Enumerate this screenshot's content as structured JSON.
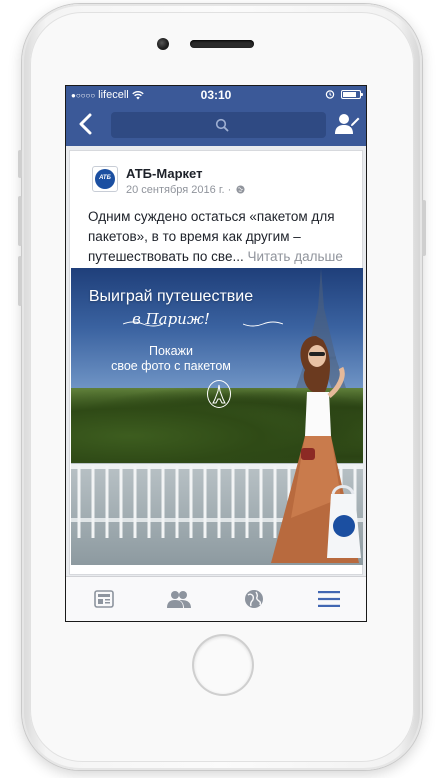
{
  "status_bar": {
    "signal_dots": "●○○○○",
    "carrier": "lifecell",
    "time": "03:10",
    "battery_level": 0.85
  },
  "nav": {
    "back_icon": "chevron-left-icon",
    "search_icon": "search-icon",
    "friends_icon": "friend-requests-icon",
    "accent_color": "#3b5998"
  },
  "post": {
    "page_name": "АТБ-Маркет",
    "avatar_logo_text": "АТБ",
    "date": "20 сентября 2016 г. · ",
    "text": "Одним суждено остаться «пакетом для пакетов», в то время как другим – путешествовать по све...",
    "read_more": " Читать дальше",
    "image": {
      "headline": "Выиграй путешествие",
      "script_line": "в Париж!",
      "subline_1": "Покажи",
      "subline_2": "свое фото с пакетом"
    }
  },
  "tab_bar": {
    "tabs": [
      {
        "icon": "news-feed-icon",
        "active": false
      },
      {
        "icon": "friends-icon",
        "active": false
      },
      {
        "icon": "globe-notifications-icon",
        "active": false
      },
      {
        "icon": "menu-icon",
        "active": true
      }
    ]
  }
}
